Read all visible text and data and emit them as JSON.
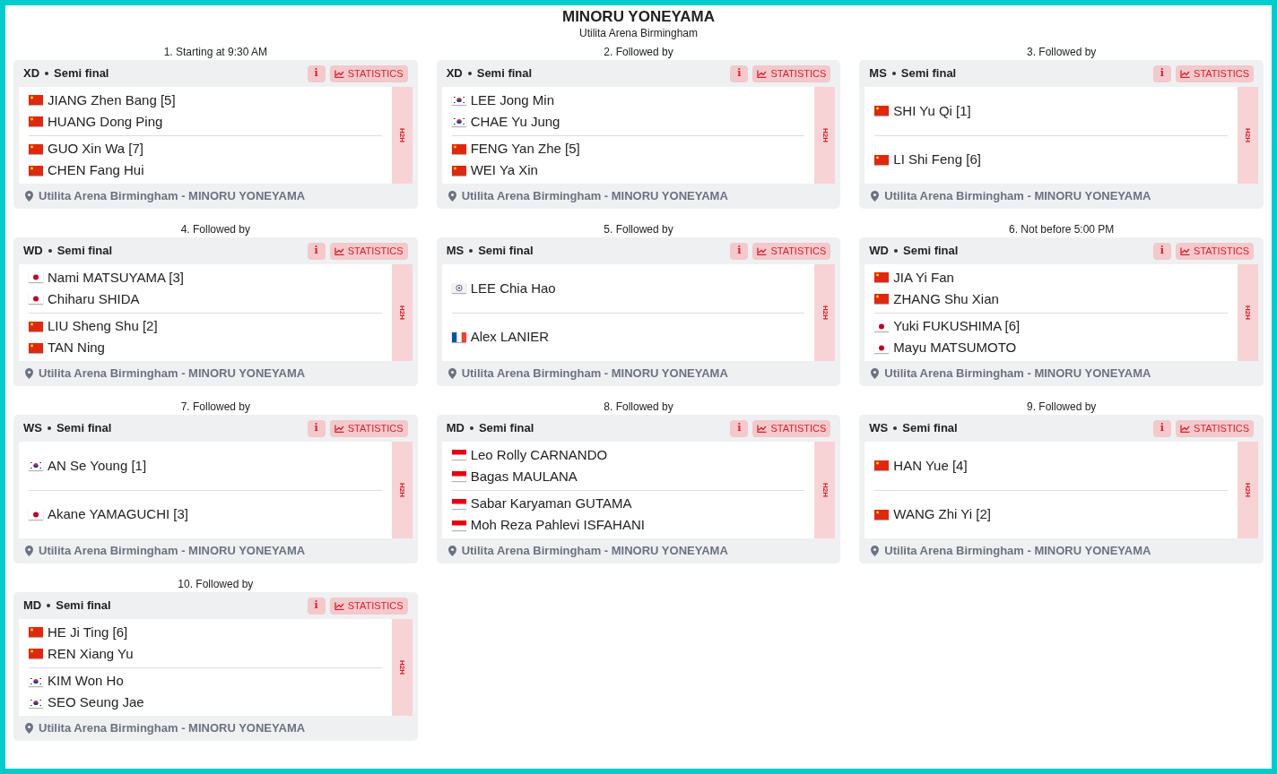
{
  "title": "MINORU YONEYAMA",
  "venue": "Utilita Arena Birmingham",
  "matches": [
    {
      "order": "1. Starting at 9:30 AM",
      "event": "XD",
      "round": "Semi final",
      "info": "i",
      "stats": "STATISTICS",
      "h2h": "H2H",
      "location": "Utilita Arena Birmingham - MINORU YONEYAMA",
      "sides": [
        [
          {
            "kind": "china",
            "name": "JIANG Zhen Bang [5]"
          },
          {
            "kind": "china",
            "name": "HUANG Dong Ping"
          }
        ],
        [
          {
            "kind": "china",
            "name": "GUO Xin Wa [7]"
          },
          {
            "kind": "china",
            "name": "CHEN Fang Hui"
          }
        ]
      ]
    },
    {
      "order": "2. Followed by",
      "event": "XD",
      "round": "Semi final",
      "info": "i",
      "stats": "STATISTICS",
      "h2h": "H2H",
      "location": "Utilita Arena Birmingham - MINORU YONEYAMA",
      "sides": [
        [
          {
            "kind": "korea",
            "name": "LEE Jong Min"
          },
          {
            "kind": "korea",
            "name": "CHAE Yu Jung"
          }
        ],
        [
          {
            "kind": "china",
            "name": "FENG Yan Zhe [5]"
          },
          {
            "kind": "china",
            "name": "WEI Ya Xin"
          }
        ]
      ]
    },
    {
      "order": "3. Followed by",
      "event": "MS",
      "round": "Semi final",
      "info": "i",
      "stats": "STATISTICS",
      "h2h": "H2H",
      "location": "Utilita Arena Birmingham - MINORU YONEYAMA",
      "sides": [
        [
          {
            "kind": "china",
            "name": "SHI Yu Qi [1]"
          }
        ],
        [
          {
            "kind": "china",
            "name": "LI Shi Feng [6]"
          }
        ]
      ]
    },
    {
      "order": "4. Followed by",
      "event": "WD",
      "round": "Semi final",
      "info": "i",
      "stats": "STATISTICS",
      "h2h": "H2H",
      "location": "Utilita Arena Birmingham - MINORU YONEYAMA",
      "sides": [
        [
          {
            "kind": "japan",
            "name": "Nami MATSUYAMA [3]"
          },
          {
            "kind": "japan",
            "name": "Chiharu SHIDA"
          }
        ],
        [
          {
            "kind": "china",
            "name": "LIU Sheng Shu [2]"
          },
          {
            "kind": "china",
            "name": "TAN Ning"
          }
        ]
      ]
    },
    {
      "order": "5. Followed by",
      "event": "MS",
      "round": "Semi final",
      "info": "i",
      "stats": "STATISTICS",
      "h2h": "H2H",
      "location": "Utilita Arena Birmingham - MINORU YONEYAMA",
      "sides": [
        [
          {
            "kind": "taipei",
            "name": "LEE Chia Hao"
          }
        ],
        [
          {
            "kind": "france",
            "name": "Alex LANIER"
          }
        ]
      ]
    },
    {
      "order": "6. Not before 5:00 PM",
      "event": "WD",
      "round": "Semi final",
      "info": "i",
      "stats": "STATISTICS",
      "h2h": "H2H",
      "location": "Utilita Arena Birmingham - MINORU YONEYAMA",
      "sides": [
        [
          {
            "kind": "china",
            "name": "JIA Yi Fan"
          },
          {
            "kind": "china",
            "name": "ZHANG Shu Xian"
          }
        ],
        [
          {
            "kind": "japan",
            "name": "Yuki FUKUSHIMA [6]"
          },
          {
            "kind": "japan",
            "name": "Mayu MATSUMOTO"
          }
        ]
      ]
    },
    {
      "order": "7. Followed by",
      "event": "WS",
      "round": "Semi final",
      "info": "i",
      "stats": "STATISTICS",
      "h2h": "H2H",
      "location": "Utilita Arena Birmingham - MINORU YONEYAMA",
      "sides": [
        [
          {
            "kind": "korea",
            "name": "AN Se Young [1]"
          }
        ],
        [
          {
            "kind": "japan",
            "name": "Akane YAMAGUCHI [3]"
          }
        ]
      ]
    },
    {
      "order": "8. Followed by",
      "event": "MD",
      "round": "Semi final",
      "info": "i",
      "stats": "STATISTICS",
      "h2h": "H2H",
      "location": "Utilita Arena Birmingham - MINORU YONEYAMA",
      "sides": [
        [
          {
            "kind": "indonesia",
            "name": "Leo Rolly CARNANDO"
          },
          {
            "kind": "indonesia",
            "name": "Bagas MAULANA"
          }
        ],
        [
          {
            "kind": "indonesia",
            "name": "Sabar Karyaman GUTAMA"
          },
          {
            "kind": "indonesia",
            "name": "Moh Reza Pahlevi ISFAHANI"
          }
        ]
      ]
    },
    {
      "order": "9. Followed by",
      "event": "WS",
      "round": "Semi final",
      "info": "i",
      "stats": "STATISTICS",
      "h2h": "H2H",
      "location": "Utilita Arena Birmingham - MINORU YONEYAMA",
      "sides": [
        [
          {
            "kind": "china",
            "name": "HAN Yue [4]"
          }
        ],
        [
          {
            "kind": "china",
            "name": "WANG Zhi Yi [2]"
          }
        ]
      ]
    },
    {
      "order": "10. Followed by",
      "event": "MD",
      "round": "Semi final",
      "info": "i",
      "stats": "STATISTICS",
      "h2h": "H2H",
      "location": "Utilita Arena Birmingham - MINORU YONEYAMA",
      "sides": [
        [
          {
            "kind": "china",
            "name": "HE Ji Ting [6]"
          },
          {
            "kind": "china",
            "name": "REN Xiang Yu"
          }
        ],
        [
          {
            "kind": "korea",
            "name": "KIM Won Ho"
          },
          {
            "kind": "korea",
            "name": "SEO Seung Jae"
          }
        ]
      ]
    }
  ]
}
